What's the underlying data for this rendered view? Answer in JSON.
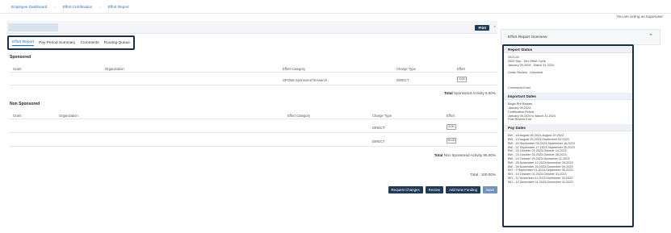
{
  "breadcrumb": [
    "Employee Dashboard",
    "Effort Certification",
    "Effort Report"
  ],
  "acting_as": "You are acting as Superuser",
  "toolbar": {
    "print_label": "Print",
    "close_label": "×"
  },
  "tabs": [
    "Effort Report",
    "Pay Period Summary",
    "Comments",
    "Routing Queue"
  ],
  "sponsored": {
    "title": "Sponsored",
    "headers": {
      "grant": "Grant",
      "org": "Organization",
      "category": "Effort Category",
      "charge": "Charge Type",
      "effort": "Effort"
    },
    "rows": [
      {
        "category": "SPONS Sponsored Research",
        "charge": "DIRECT",
        "effort": "5.00"
      }
    ],
    "total": {
      "label": "Total",
      "value": "Sponsored Activity 5.00%"
    }
  },
  "nonsponsored": {
    "title": "Non Sponsored",
    "headers": {
      "grant": "Grant",
      "org": "Organization",
      "category": "Effort Category",
      "charge": "Charge Type",
      "effort": "Effort"
    },
    "rows": [
      {
        "charge": "DIRECT",
        "effort": "5.00"
      },
      {
        "charge": "DIRECT",
        "effort": "90.00"
      }
    ],
    "total": {
      "label": "Total",
      "value": "Non Sponsored Activity 95.00%"
    }
  },
  "grand_total": "Total : 100.00%",
  "actions": [
    "Request Changes",
    "Review",
    "Add New Funding",
    "Save"
  ],
  "overview": {
    "title": "Effort Report Overview",
    "status_title": "Report Status",
    "status_lines": [
      "2023-02",
      "2023 Sep - Dec Effort Cycle",
      "January 09,2024 - March 31,2024",
      "",
      "Under Review - Unlocked",
      "",
      "",
      "",
      "Comments Exist"
    ],
    "dates_title": "Important Dates",
    "dates_lines": [
      "Begin Pre Review",
      "January 09,2024",
      "Certification Period",
      "January 09,2024 to March 31,2024",
      "Post Review End"
    ],
    "pay_title": "Pay Dates",
    "pay_lines": [
      "BW - 18 August 06,2023-August 19,2023",
      "BW - 19 August 20,2023-September 02,2023",
      "BW - 20 September 03,2023-September 16,2023",
      "BW - 21 September 17,2023-September 30,2023",
      "BW - 22 October 01,2023-October 14,2023",
      "BW - 23 October 15,2023-October 28,2023",
      "BW - 24 October 29,2023-November 11,2023",
      "BW - 25 November 12,2023-November 25,2023",
      "BW - 26 November 26,2023-December 09,2023",
      "MO - 9 September 01,2023-September 30,2023",
      "MO - 10 October 01,2023-October 31,2023",
      "MO - 11 November 01,2023-November 30,2023",
      "MO - 12 December 01,2023-December 31,2023"
    ]
  }
}
